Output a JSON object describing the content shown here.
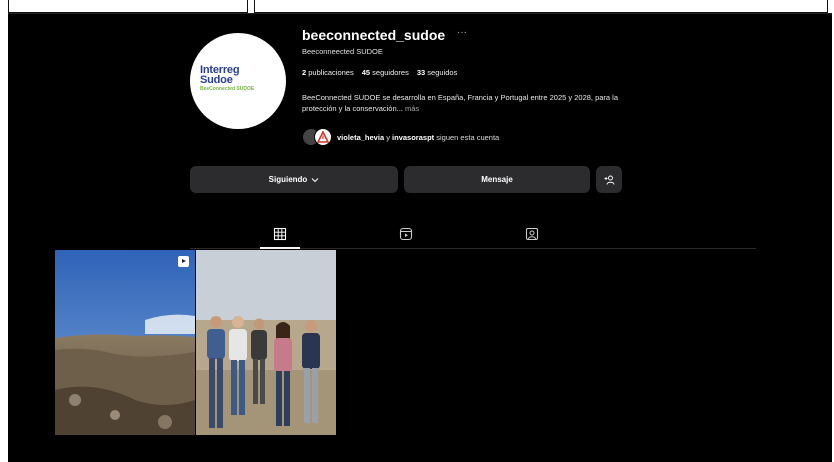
{
  "profile": {
    "username": "beeconnected_sudoe",
    "more_icon": "ellipsis-icon",
    "full_name": "Beeconneected SUDOE",
    "avatar_logo_line1": "Interreg",
    "avatar_logo_line2": "Sudoe",
    "avatar_logo_line3": "BeeConnected SUDOE"
  },
  "stats": {
    "posts_count": "2",
    "posts_label": "publicaciones",
    "followers_count": "45",
    "followers_label": "seguidores",
    "following_count": "33",
    "following_label": "seguidos"
  },
  "bio": {
    "text": "BeeConnected SUDOE se desarrolla en España, Francia y Portugal entre 2025 y 2028, para la protección y la conservación...",
    "more_label": "más"
  },
  "followed_by": {
    "user1": "violeta_hevia",
    "connector": "y",
    "user2": "invasoraspt",
    "suffix": "siguen esta cuenta"
  },
  "actions": {
    "following_label": "Siguiendo",
    "message_label": "Mensaje",
    "add_icon": "add-person-icon"
  },
  "tabs": [
    {
      "name": "posts",
      "icon": "grid-icon",
      "active": true
    },
    {
      "name": "reels",
      "icon": "reels-icon",
      "active": false
    },
    {
      "name": "tagged",
      "icon": "tagged-icon",
      "active": false
    }
  ],
  "colors": {
    "background": "#000000",
    "button": "#2c2c2e",
    "text": "#f5f5f5",
    "muted": "#a8a8a8"
  }
}
